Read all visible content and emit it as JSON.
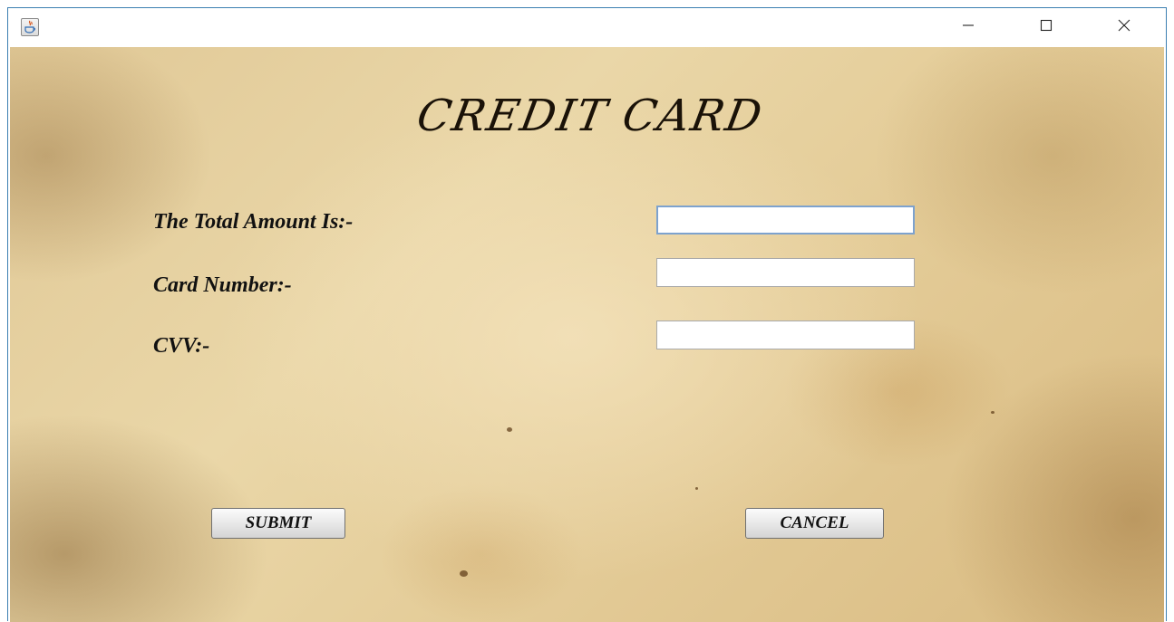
{
  "window": {
    "controls": {
      "minimize_icon": "minimize-icon",
      "maximize_icon": "maximize-icon",
      "close_icon": "close-icon"
    },
    "app_icon": "java-cup-icon"
  },
  "form": {
    "title": "CREDIT CARD",
    "fields": [
      {
        "label": "The Total Amount Is:-",
        "value": "",
        "placeholder": ""
      },
      {
        "label": "Card Number:-",
        "value": "",
        "placeholder": ""
      },
      {
        "label": "CVV:-",
        "value": "",
        "placeholder": ""
      }
    ],
    "buttons": {
      "submit": "SUBMIT",
      "cancel": "CANCEL"
    }
  },
  "colors": {
    "parchment": "#e4cc98",
    "window_border": "#3c7fb1",
    "focus_border": "#7da2ce"
  }
}
